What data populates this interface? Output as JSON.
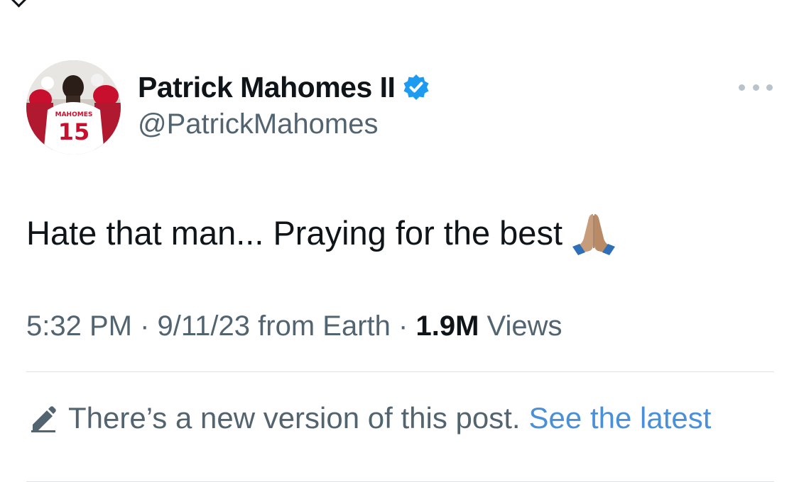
{
  "tweet": {
    "author": {
      "display_name": "Patrick Mahomes II",
      "handle": "@PatrickMahomes",
      "verified": true,
      "avatar_jersey_name": "MAHOMES",
      "avatar_jersey_number": "15"
    },
    "text": "Hate that man... Praying for the best",
    "emoji": "folded-hands",
    "meta": {
      "time": "5:32 PM",
      "separator": "·",
      "date": "9/11/23",
      "source": "from Earth",
      "views_count": "1.9M",
      "views_label": "Views"
    },
    "edit_notice": {
      "text": "There’s a new version of this post.",
      "link_label": "See the latest"
    }
  },
  "colors": {
    "text_primary": "#0f1419",
    "text_secondary": "#536471",
    "link": "#4a90d9",
    "verified_badge": "#1d9bf0",
    "divider": "#dfe3e6",
    "jersey_red": "#c8102e"
  },
  "icons": {
    "verified": "verified-badge-icon",
    "more": "more-options-icon",
    "edit": "pencil-icon",
    "back": "back-arrow-icon"
  }
}
